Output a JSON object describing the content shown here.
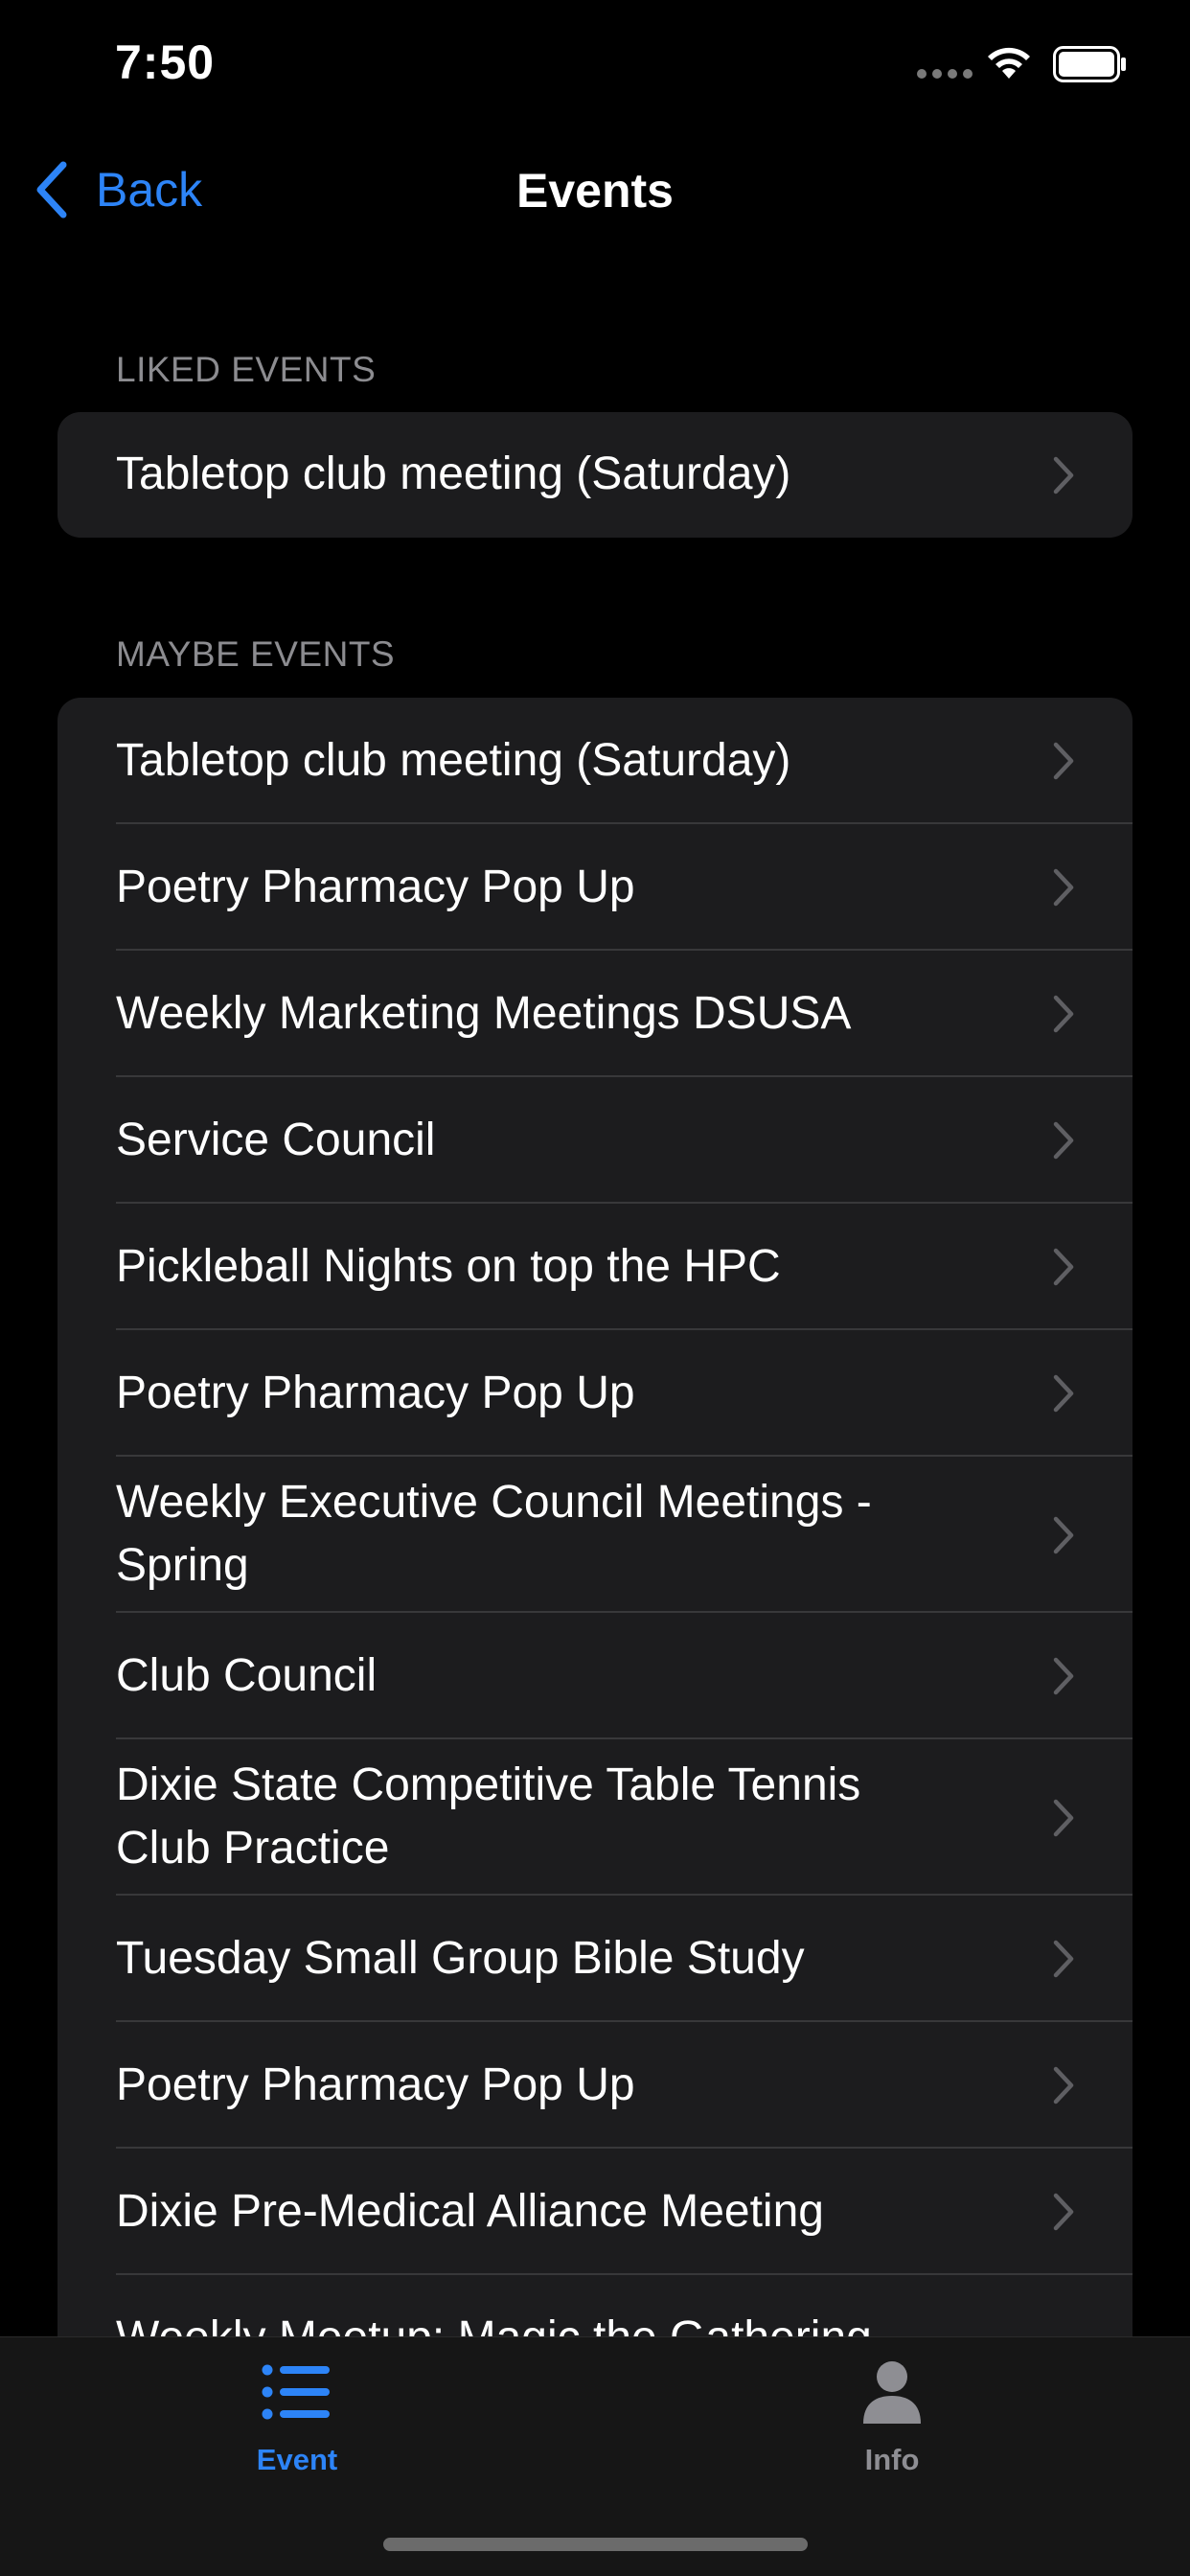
{
  "status": {
    "time": "7:50"
  },
  "nav": {
    "back_label": "Back",
    "title": "Events"
  },
  "liked": {
    "header": "LIKED EVENTS",
    "items": [
      {
        "label": "Tabletop club meeting (Saturday)"
      }
    ]
  },
  "maybe": {
    "header": "MAYBE EVENTS",
    "items": [
      {
        "label": "Tabletop club meeting (Saturday)"
      },
      {
        "label": "Poetry Pharmacy Pop Up"
      },
      {
        "label": "Weekly Marketing Meetings DSUSA"
      },
      {
        "label": "Service Council"
      },
      {
        "label": "Pickleball Nights on top the HPC"
      },
      {
        "label": "Poetry Pharmacy Pop Up"
      },
      {
        "label": "Weekly Executive Council Meetings - Spring"
      },
      {
        "label": "Club Council"
      },
      {
        "label": "Dixie State Competitive Table Tennis Club Practice"
      },
      {
        "label": "Tuesday Small Group Bible Study"
      },
      {
        "label": "Poetry Pharmacy Pop Up"
      },
      {
        "label": "Dixie Pre-Medical Alliance Meeting"
      },
      {
        "label": "Weekly Meetup: Magic the Gathering"
      }
    ]
  },
  "tabs": [
    {
      "label": "Event",
      "icon": "list-icon",
      "active": true
    },
    {
      "label": "Info",
      "icon": "person-icon",
      "active": false
    }
  ],
  "colors": {
    "accent": "#2d84f7",
    "background": "#000000",
    "cell": "#1c1c1e",
    "secondary_text": "#8c8c90"
  }
}
